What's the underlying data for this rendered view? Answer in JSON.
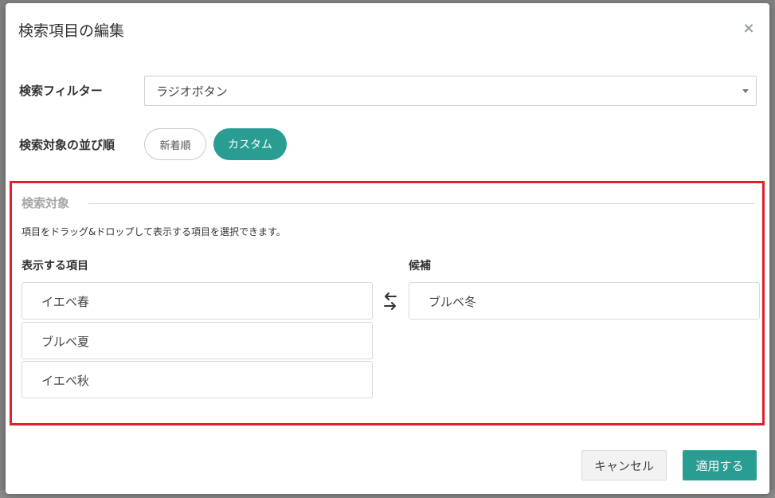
{
  "modal": {
    "title": "検索項目の編集",
    "close_icon": "close-icon"
  },
  "filter": {
    "label": "検索フィルター",
    "value": "ラジオボタン"
  },
  "sort": {
    "label": "検索対象の並び順",
    "options": [
      "新着順",
      "カスタム"
    ],
    "selected": "カスタム"
  },
  "targets": {
    "section_title": "検索対象",
    "help_text": "項目をドラッグ&ドロップして表示する項目を選択できます。",
    "shown_label": "表示する項目",
    "shown_items": [
      "イエベ春",
      "ブルベ夏",
      "イエベ秋"
    ],
    "candidates_label": "候補",
    "candidate_items": [
      "ブルベ冬"
    ],
    "swap_icon": "swap-arrows-icon"
  },
  "footer": {
    "cancel_label": "キャンセル",
    "apply_label": "適用する"
  },
  "colors": {
    "accent": "#2a9d93",
    "highlight_border": "#e0202a"
  }
}
